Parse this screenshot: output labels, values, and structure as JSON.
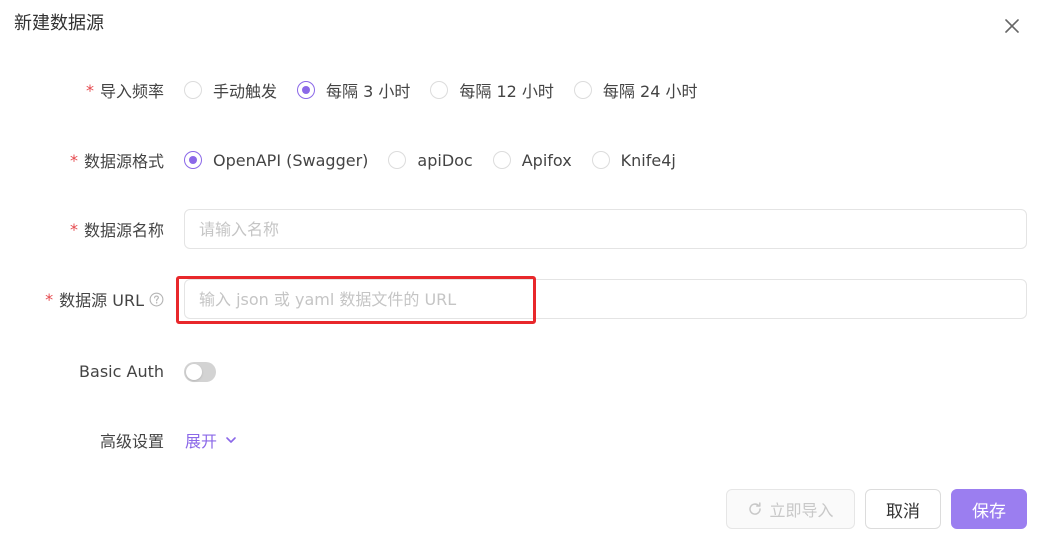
{
  "dialog": {
    "title": "新建数据源"
  },
  "form": {
    "import_frequency": {
      "label": "导入频率",
      "options": [
        "手动触发",
        "每隔 3 小时",
        "每隔 12 小时",
        "每隔 24 小时"
      ],
      "selected": "每隔 3 小时"
    },
    "source_format": {
      "label": "数据源格式",
      "options": [
        "OpenAPI (Swagger)",
        "apiDoc",
        "Apifox",
        "Knife4j"
      ],
      "selected": "OpenAPI (Swagger)"
    },
    "source_name": {
      "label": "数据源名称",
      "placeholder": "请输入名称",
      "value": ""
    },
    "source_url": {
      "label": "数据源 URL",
      "placeholder": "输入 json 或 yaml 数据文件的 URL",
      "value": ""
    },
    "basic_auth": {
      "label": "Basic Auth",
      "enabled": false
    },
    "advanced": {
      "label": "高级设置",
      "toggle_label": "展开"
    }
  },
  "footer": {
    "import_now_label": "立即导入",
    "cancel_label": "取消",
    "save_label": "保存"
  },
  "colors": {
    "accent": "#8b68e8",
    "required": "#e5484d",
    "highlight": "#e8282b"
  }
}
